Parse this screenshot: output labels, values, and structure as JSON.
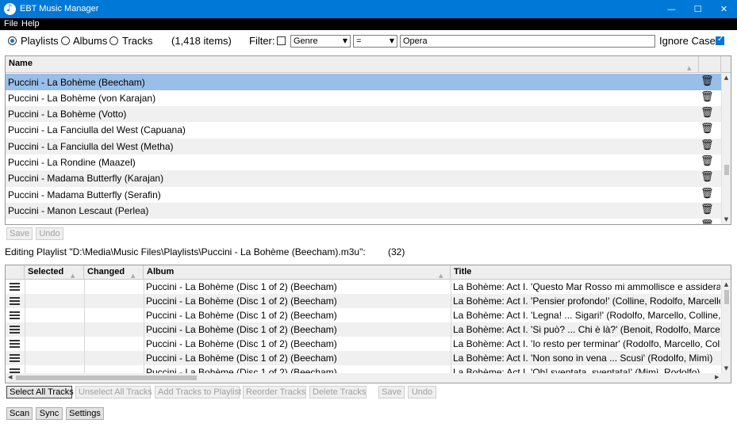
{
  "window": {
    "title": "EBT Music Manager",
    "minimize": "—",
    "maximize": "☐",
    "close": "✕"
  },
  "menu": [
    "File",
    "Help"
  ],
  "view_options": {
    "playlists": "Playlists",
    "albums": "Albums",
    "tracks": "Tracks",
    "selected": "Playlists",
    "item_count": "(1,418 items)"
  },
  "filter": {
    "label": "Filter:",
    "enabled": false,
    "field": "Genre",
    "operator": "=",
    "value": "Opera",
    "ignore_case_label": "Ignore Case",
    "ignore_case": true
  },
  "playlists_table": {
    "column": "Name",
    "selected_index": 0,
    "rows": [
      "Puccini - La Bohème (Beecham)",
      "Puccini - La Bohème (von Karajan)",
      "Puccini - La Bohème (Votto)",
      "Puccini - La Fanciulla del West (Capuana)",
      "Puccini - La Fanciulla del West (Metha)",
      "Puccini - La Rondine (Maazel)",
      "Puccini - Madama Butterfly (Karajan)",
      "Puccini - Madama Butterfly (Serafin)",
      "Puccini - Manon Lescaut (Perlea)"
    ],
    "delete_icon": "trash-icon"
  },
  "playlist_buttons": {
    "save": "Save",
    "undo": "Undo"
  },
  "editing": {
    "label": "Editing Playlist \"D:\\Media\\Music Files\\Playlists\\Puccini - La Bohème (Beecham).m3u\":",
    "count": "(32)"
  },
  "tracks_table": {
    "columns": [
      "Selected",
      "Changed",
      "Album",
      "Title"
    ],
    "drag_icon": "drag-handle-icon",
    "rows": [
      {
        "album": "Puccini - La Bohème (Disc 1 of 2) (Beecham)",
        "title": "La Bohème: Act I. 'Questo Mar Rosso mi ammollisce e assidera' (Marcello"
      },
      {
        "album": "Puccini - La Bohème (Disc 1 of 2) (Beecham)",
        "title": "La Bohème: Act I. 'Pensier profondo!' (Colline, Rodolfo, Marcello)"
      },
      {
        "album": "Puccini - La Bohème (Disc 1 of 2) (Beecham)",
        "title": "La Bohème: Act I. 'Legna! ... Sigari!' (Rodolfo, Marcello, Colline, Schauna"
      },
      {
        "album": "Puccini - La Bohème (Disc 1 of 2) (Beecham)",
        "title": "La Bohème: Act I. 'Si può? ... Chi è là?' (Benoit, Rodolfo, Marcello, Colline"
      },
      {
        "album": "Puccini - La Bohème (Disc 1 of 2) (Beecham)",
        "title": "La Bohème: Act I. 'Io resto per terminar' (Rodolfo, Marcello, Colline, Scha"
      },
      {
        "album": "Puccini - La Bohème (Disc 1 of 2) (Beecham)",
        "title": "La Bohème: Act I. 'Non sono in vena ... Scusi' (Rodolfo, Mimì)"
      },
      {
        "album": "Puccini - La Bohème (Disc 1 of 2) (Beecham)",
        "title": "La Bohème: Act I. 'Oh! sventata, sventata!' (Mimì, Rodolfo)"
      }
    ]
  },
  "track_buttons": {
    "select_all": "Select All Tracks",
    "unselect_all": "Unselect All Tracks",
    "add_tracks": "Add Tracks to Playlist",
    "reorder": "Reorder Tracks",
    "delete": "Delete Tracks",
    "save": "Save",
    "undo": "Undo"
  },
  "footer_buttons": {
    "scan": "Scan",
    "sync": "Sync",
    "settings": "Settings"
  },
  "colors": {
    "titlebar": "#0078d7",
    "selected_row": "#99bfe8"
  }
}
